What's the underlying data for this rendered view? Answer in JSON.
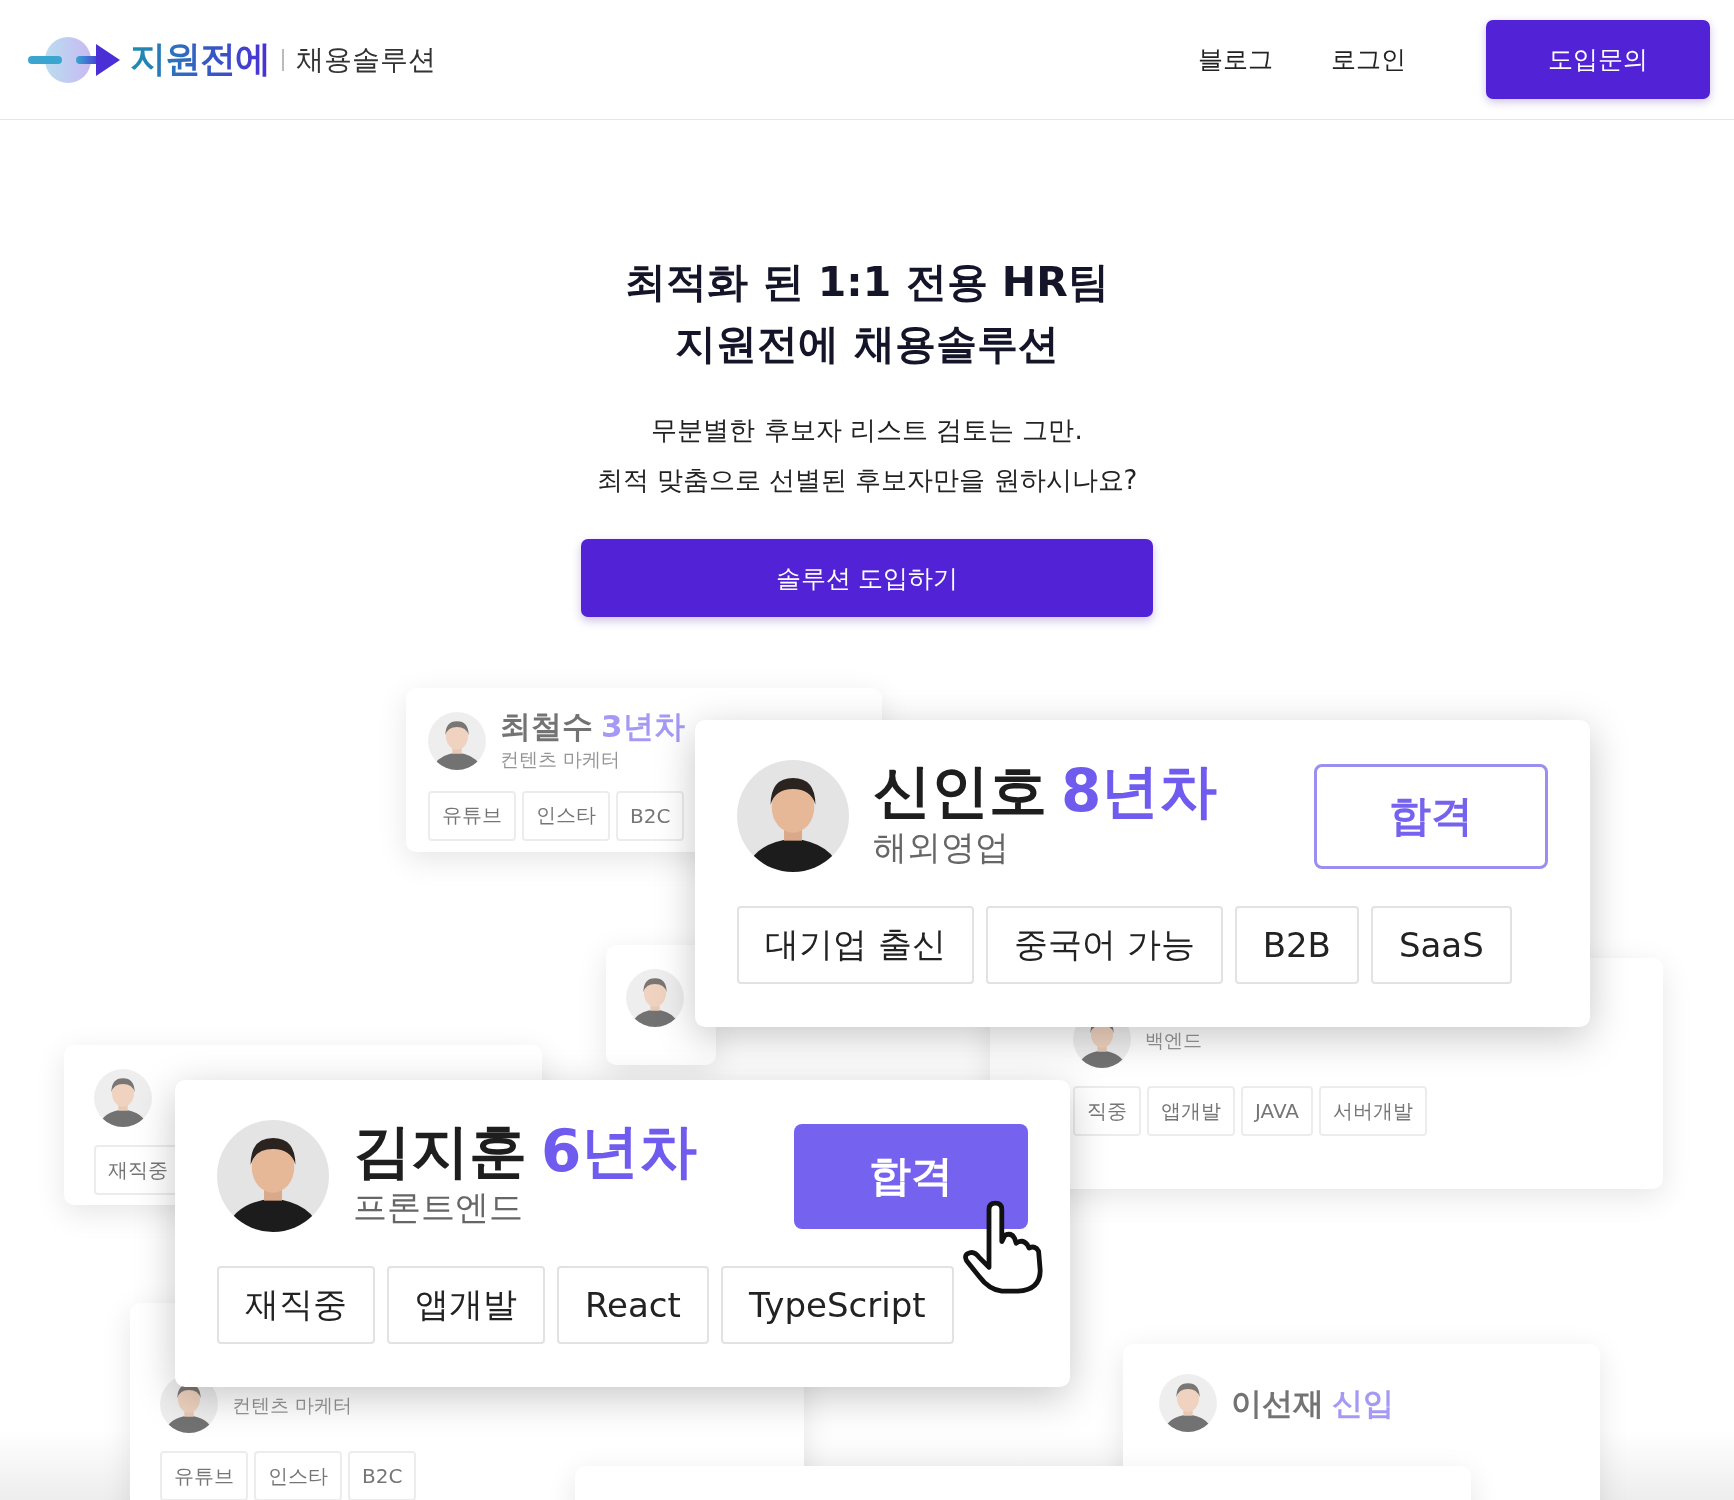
{
  "header": {
    "brand": "지원전에",
    "product": "채용솔루션",
    "nav": [
      {
        "label": "블로그"
      },
      {
        "label": "로그인"
      }
    ],
    "cta": "도입문의"
  },
  "hero": {
    "title_lines": [
      "최적화 된 1:1 전용 HR팀",
      "지원전에 채용솔루션"
    ],
    "subtitle_lines": [
      "무분별한 후보자 리스트 검토는 그만.",
      "최적 맞춤으로 선별된 후보자만을 원하시나요?"
    ],
    "button": "솔루션 도입하기"
  },
  "cards": [
    {
      "kind": "back",
      "photo": true,
      "name": "최철수",
      "experience": "3년차",
      "role": "컨텐츠 마케터",
      "tags": [
        "유튜브",
        "인스타",
        "B2C"
      ]
    },
    {
      "kind": "back",
      "photo": true
    },
    {
      "kind": "back",
      "photo": true,
      "role": "백엔드",
      "tags": [
        "직중",
        "앱개발",
        "JAVA",
        "서버개발"
      ]
    },
    {
      "kind": "back",
      "photo": true,
      "tags": [
        "재직중"
      ]
    },
    {
      "kind": "back",
      "photo": true,
      "role": "컨텐츠 마케터",
      "tags": [
        "유튜브",
        "인스타",
        "B2C"
      ]
    },
    {
      "kind": "back",
      "photo": true,
      "name": "이선재",
      "experience": "신입"
    },
    {
      "kind": "back",
      "photo": false
    },
    {
      "kind": "front",
      "photo": true,
      "name": "신인호",
      "experience": "8년차",
      "role": "해외영업",
      "status": {
        "label": "합격",
        "selected": false
      },
      "tags": [
        "대기업 출신",
        "중국어 가능",
        "B2B",
        "SaaS"
      ]
    },
    {
      "kind": "front",
      "photo": true,
      "name": "김지훈",
      "experience": "6년차",
      "role": "프론트엔드",
      "status": {
        "label": "합격",
        "selected": true
      },
      "tags": [
        "재직중",
        "앱개발",
        "React",
        "TypeScript"
      ]
    }
  ]
}
